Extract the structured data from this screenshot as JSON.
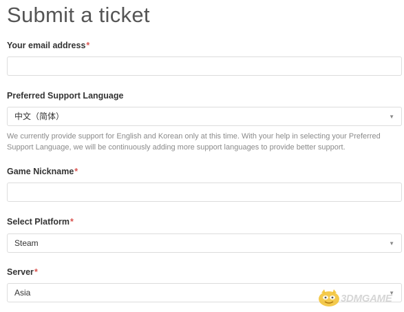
{
  "page": {
    "title": "Submit a ticket"
  },
  "form": {
    "email": {
      "label": "Your email address",
      "required_mark": "*",
      "value": ""
    },
    "language": {
      "label": "Preferred Support Language",
      "selected": "中文（简体）",
      "help_text": "We currently provide support for English and Korean only at this time. With your help in selecting your Preferred Support Language, we will be continuously adding more support languages to provide better support."
    },
    "nickname": {
      "label": "Game Nickname",
      "required_mark": "*",
      "value": ""
    },
    "platform": {
      "label": "Select Platform",
      "required_mark": "*",
      "selected": "Steam"
    },
    "server": {
      "label": "Server",
      "required_mark": "*",
      "selected": "Asia"
    },
    "dropdown_arrow": "▼"
  },
  "watermark": {
    "text": "3DMGAME",
    "icon": "3dmgame-mascot-logo"
  },
  "colors": {
    "required": "#d9534f",
    "border": "#dcdcdc",
    "help_text": "#8a8a8a",
    "title": "#555555",
    "watermark": "#d6d6d6"
  }
}
